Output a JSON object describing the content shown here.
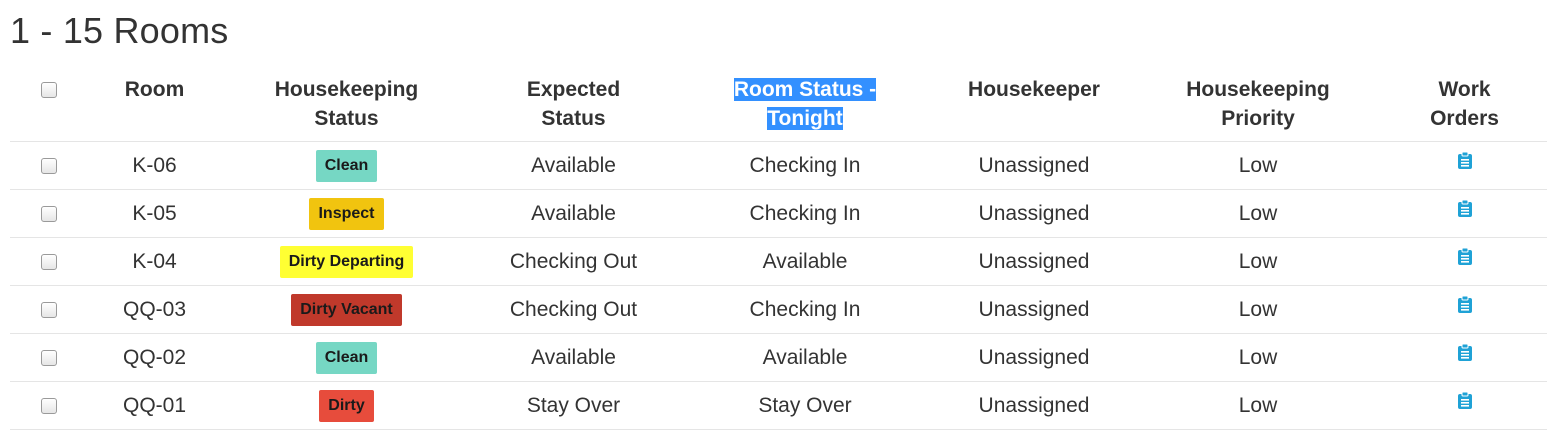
{
  "page": {
    "title": "1 - 15 Rooms"
  },
  "table": {
    "headers": {
      "room": "Room",
      "housekeeping_status_line1": "Housekeeping",
      "housekeeping_status_line2": "Status",
      "expected_status_line1": "Expected",
      "expected_status_line2": "Status",
      "room_status_line1": "Room Status -",
      "room_status_line2": "Tonight",
      "housekeeper": "Housekeeper",
      "priority_line1": "Housekeeping",
      "priority_line2": "Priority",
      "work_orders_line1": "Work",
      "work_orders_line2": "Orders"
    },
    "rows": [
      {
        "room": "K-06",
        "hk_status": "Clean",
        "hk_color": "#76d7c4",
        "expected": "Available",
        "tonight": "Checking In",
        "housekeeper": "Unassigned",
        "priority": "Low"
      },
      {
        "room": "K-05",
        "hk_status": "Inspect",
        "hk_color": "#f1c40f",
        "expected": "Available",
        "tonight": "Checking In",
        "housekeeper": "Unassigned",
        "priority": "Low"
      },
      {
        "room": "K-04",
        "hk_status": "Dirty Departing",
        "hk_color": "#ffff33",
        "expected": "Checking Out",
        "tonight": "Available",
        "housekeeper": "Unassigned",
        "priority": "Low"
      },
      {
        "room": "QQ-03",
        "hk_status": "Dirty Vacant",
        "hk_color": "#c0392b",
        "expected": "Checking Out",
        "tonight": "Checking In",
        "housekeeper": "Unassigned",
        "priority": "Low"
      },
      {
        "room": "QQ-02",
        "hk_status": "Clean",
        "hk_color": "#76d7c4",
        "expected": "Available",
        "tonight": "Available",
        "housekeeper": "Unassigned",
        "priority": "Low"
      },
      {
        "room": "QQ-01",
        "hk_status": "Dirty",
        "hk_color": "#e74c3c",
        "expected": "Stay Over",
        "tonight": "Stay Over",
        "housekeeper": "Unassigned",
        "priority": "Low"
      }
    ]
  },
  "colors": {
    "selection": "#3390ff",
    "work_order_icon": "#1fa2d6",
    "row_border": "#e5e5e5"
  },
  "icons": {
    "work_order": "clipboard-icon"
  }
}
